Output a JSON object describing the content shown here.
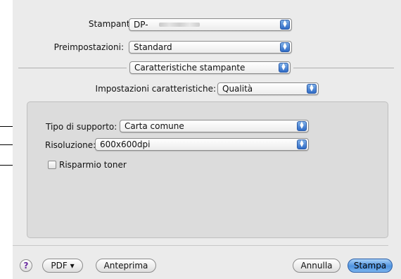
{
  "dialog": {
    "printer_label": "Stampante:",
    "printer_value": "DP-",
    "presets_label": "Preimpostazioni:",
    "presets_value": "Standard",
    "pane_value": "Caratteristiche stampante",
    "feature_settings_label": "Impostazioni caratteristiche:",
    "feature_settings_value": "Qualità"
  },
  "panel": {
    "media_type_label": "Tipo di supporto:",
    "media_type_value": "Carta comune",
    "resolution_label": "Risoluzione:",
    "resolution_value": "600x600dpi",
    "toner_save_label": "Risparmio toner",
    "toner_save_checked": false
  },
  "footer": {
    "help_label": "?",
    "pdf_label": "PDF ▾",
    "preview_label": "Anteprima",
    "cancel_label": "Annulla",
    "print_label": "Stampa"
  },
  "colors": {
    "dialog_bg": "#ebebeb",
    "panel_bg": "#dcdcdc",
    "accent_blue": "#4f93e0"
  }
}
